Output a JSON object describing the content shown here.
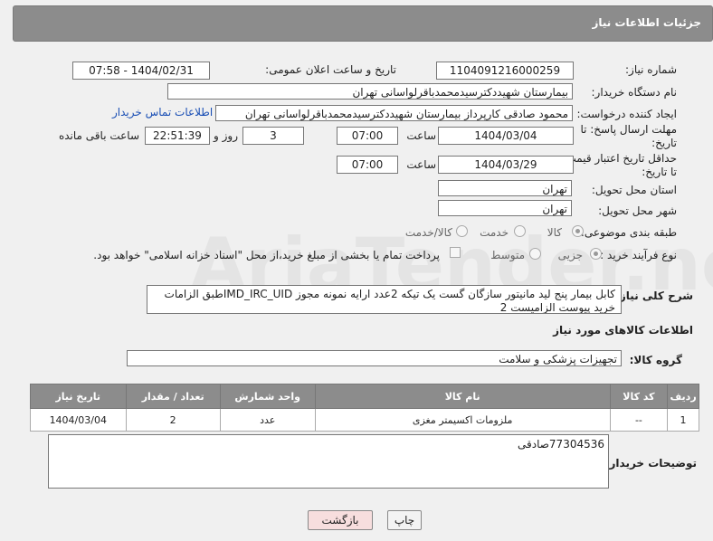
{
  "header": {
    "title": "جزئیات اطلاعات نیاز"
  },
  "form": {
    "need_number_label": "شماره نیاز:",
    "need_number": "1104091216000259",
    "announce_label": "تاریخ و ساعت اعلان عمومی:",
    "announce_value": "1404/02/31 - 07:58",
    "buyer_org_label": "نام دستگاه خریدار:",
    "buyer_org": "بیمارستان شهیددکترسیدمحمدباقرلواسانی تهران",
    "creator_label": "ایجاد کننده درخواست:",
    "creator": "محمود صادقی کارپرداز بیمارستان شهیددکترسیدمحمدباقرلواسانی تهران",
    "contact_link": "اطلاعات تماس خریدار",
    "reply_deadline_label_1": "مهلت ارسال پاسخ: تا",
    "reply_deadline_label_2": "تاریخ:",
    "reply_date": "1404/03/04",
    "time_label": "ساعت",
    "reply_time": "07:00",
    "days_value": "3",
    "days_label": "روز و",
    "remaining_time": "22:51:39",
    "remaining_label": "ساعت باقی مانده",
    "price_deadline_label_1": "حداقل تاریخ اعتبار قیمت:",
    "price_deadline_label_2": "تا تاریخ:",
    "price_date": "1404/03/29",
    "price_time": "07:00",
    "province_label": "استان محل تحویل:",
    "province": "تهران",
    "city_label": "شهر محل تحویل:",
    "city": "تهران",
    "category_label": "طبقه بندی موضوعی:",
    "category_options": [
      "کالا",
      "خدمت",
      "کالا/خدمت"
    ],
    "process_label": "نوع فرآیند خرید :",
    "process_options": [
      "جزیی",
      "متوسط"
    ],
    "payment_note": "پرداخت تمام یا بخشی از مبلغ خرید،از محل \"اسناد خزانه اسلامی\" خواهد بود.",
    "description_label": "شرح کلی نیاز:",
    "description": "کابل بیمار پنج لید مانیتور سازگان گست یک تیکه 2عدد ارایه نمونه مجوز IMD_IRC_UIDطبق الزامات خرید پیوست الزامیست 2",
    "goods_info_label": "اطلاعات کالاهای مورد نیاز",
    "goods_group_label": "گروه کالا:",
    "goods_group": "تجهیزات پزشکی و سلامت"
  },
  "table": {
    "headers": [
      "ردیف",
      "کد کالا",
      "نام کالا",
      "واحد شمارش",
      "تعداد / مقدار",
      "تاریخ نیاز"
    ],
    "rows": [
      [
        "1",
        "--",
        "ملزومات اکسیمتر مغزی",
        "عدد",
        "2",
        "1404/03/04"
      ]
    ]
  },
  "buyer_notes_label": "توضیحات خریدار:",
  "buyer_notes": "77304536صادقی",
  "buttons": {
    "print": "چاپ",
    "back": "بازگشت"
  },
  "colors": {
    "header_bg": "#8c8c8c",
    "link": "#1a4fb5",
    "back_button": "#f7dede"
  },
  "watermark_text": "AriaTender.neT"
}
